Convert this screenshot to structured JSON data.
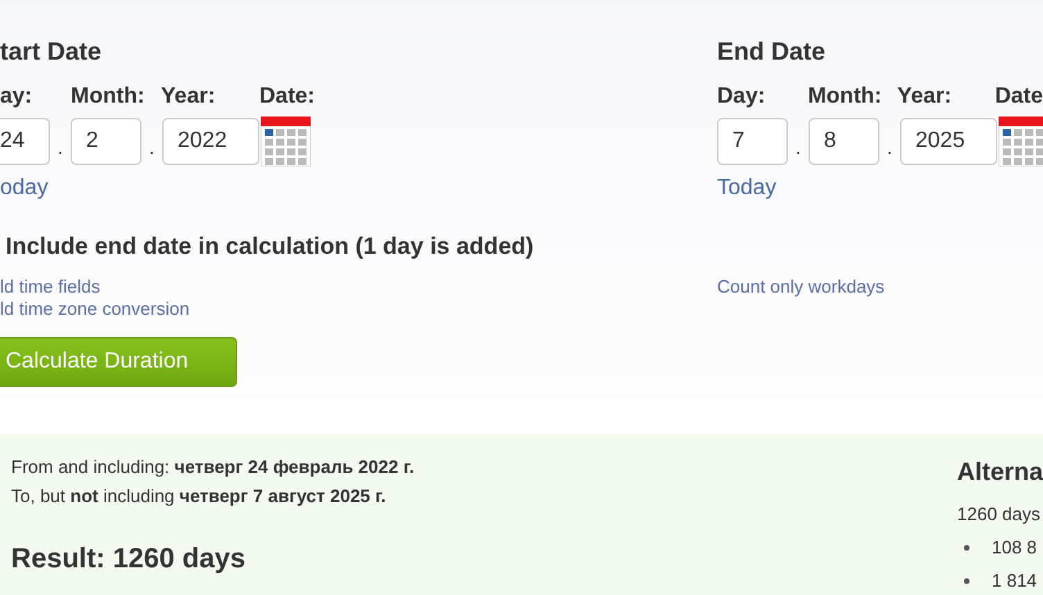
{
  "dates": [
    {
      "heading": "tart Date",
      "labels": [
        "ay:",
        "Month:",
        "Year:",
        "Date:"
      ],
      "day": "24",
      "month": "2",
      "year": "2022",
      "separators": [
        ".",
        "."
      ],
      "today": "oday",
      "cut_left": true
    },
    {
      "heading": "End Date",
      "labels": [
        "Day:",
        "Month:",
        "Year:",
        "Date"
      ],
      "day": "7",
      "month": "8",
      "year": "2025",
      "separators": [
        ".",
        "."
      ],
      "today": "Today",
      "cut_left": false
    }
  ],
  "include_end": {
    "label": "Include end date in calculation (1 day is added)"
  },
  "links": [
    "ld time fields",
    "ld time zone conversion"
  ],
  "workdays_link": "Count only workdays",
  "button": "Calculate Duration",
  "result": {
    "from": "From and including: **четверг 24 февраль 2022 г.**",
    "to": "To, but **not** including **четверг 7 август 2025 г.**",
    "result": "Result: 1260 days"
  },
  "alternative": {
    "heading": "Alterna",
    "text": "1260 days",
    "items": [
      "108 8",
      "1 814"
    ]
  }
}
